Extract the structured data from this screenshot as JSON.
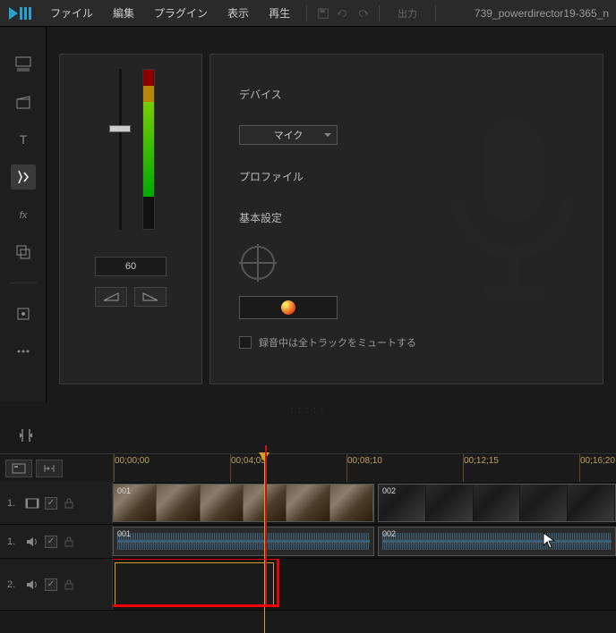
{
  "menubar": {
    "items": [
      "ファイル",
      "編集",
      "プラグイン",
      "表示",
      "再生"
    ],
    "output_label": "出力",
    "filename": "739_powerdirector19-365_n"
  },
  "volume": {
    "value": "60"
  },
  "record": {
    "device_label": "デバイス",
    "device_value": "マイク",
    "profile_label": "プロファイル",
    "settings_label": "基本設定",
    "mute_label": "録音中は全トラックをミュートする"
  },
  "timeline": {
    "ticks": [
      "00;00;00",
      "00;04;05",
      "00;08;10",
      "00;12;15",
      "00;16;20"
    ],
    "tracks": [
      {
        "num": "1.",
        "type": "video"
      },
      {
        "num": "1.",
        "type": "audio"
      },
      {
        "num": "2.",
        "type": "audio"
      }
    ],
    "clips": {
      "v1a": "001",
      "v1b": "002",
      "a1a": "001",
      "a1b": "002"
    }
  }
}
